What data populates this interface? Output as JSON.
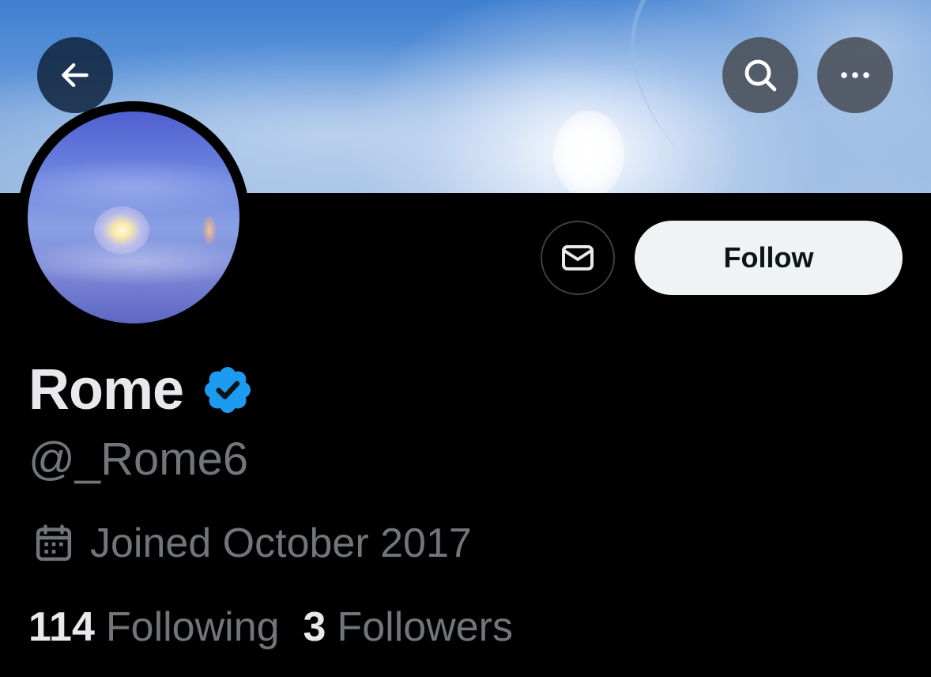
{
  "header": {
    "back_icon": "arrow-left-icon",
    "search_icon": "search-icon",
    "more_icon": "more-horizontal-icon"
  },
  "profile": {
    "display_name": "Rome",
    "verified_icon": "verified-badge-icon",
    "verified_color": "#1d9bf0",
    "handle": "@_Rome6",
    "joined_icon": "calendar-icon",
    "joined": "Joined October 2017",
    "stats": {
      "following_count": "114",
      "following_label": "Following",
      "followers_count": "3",
      "followers_label": "Followers"
    }
  },
  "actions": {
    "message_icon": "envelope-icon",
    "follow_label": "Follow"
  },
  "colors": {
    "background": "#000000",
    "primary_text": "#e7e9ea",
    "secondary_text": "#71767b",
    "follow_button_bg": "#eff3f4",
    "follow_button_text": "#0f1419"
  }
}
